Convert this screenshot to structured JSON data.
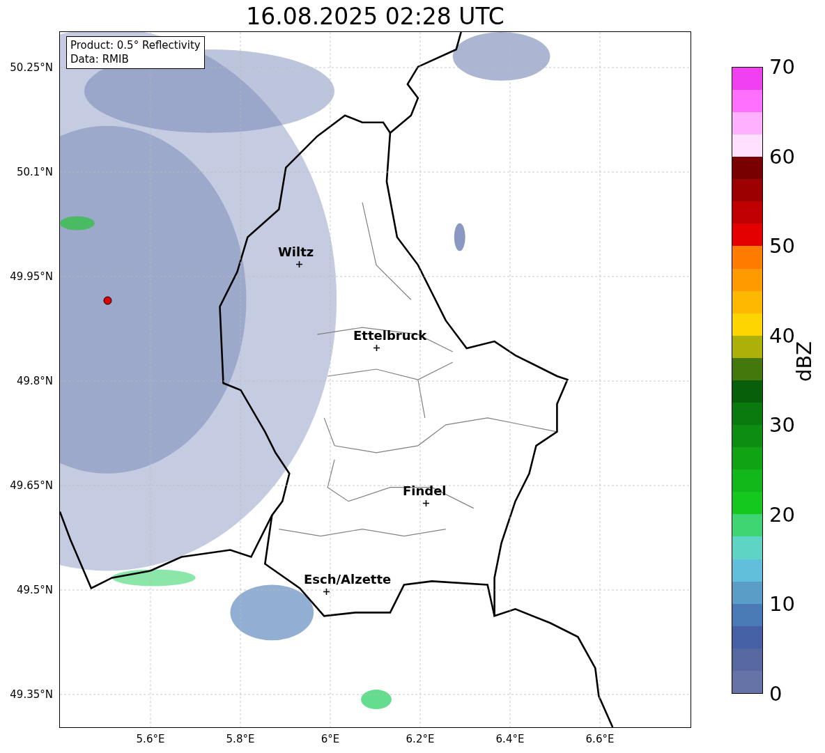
{
  "title": "16.08.2025 02:28 UTC",
  "info_box": {
    "lines": [
      "Product: 0.5° Reflectivity",
      "Data: RMIB"
    ]
  },
  "map": {
    "cities": [
      {
        "name": "Wiltz"
      },
      {
        "name": "Ettelbruck"
      },
      {
        "name": "Findel"
      },
      {
        "name": "Esch/Alzette"
      }
    ],
    "y_ticks": [
      "50.25°N",
      "50.1°N",
      "49.95°N",
      "49.8°N",
      "49.65°N",
      "49.5°N",
      "49.35°N"
    ],
    "x_ticks": [
      "5.6°E",
      "5.8°E",
      "6°E",
      "6.2°E",
      "6.4°E",
      "6.6°E"
    ]
  },
  "colorbar": {
    "label": "dBZ",
    "ticks": [
      "70",
      "60",
      "50",
      "40",
      "30",
      "20",
      "10",
      "0"
    ],
    "segments": [
      {
        "color": "#6673a6"
      },
      {
        "color": "#5767a0"
      },
      {
        "color": "#4560a5"
      },
      {
        "color": "#4a7ab5"
      },
      {
        "color": "#5a9ec8"
      },
      {
        "color": "#62bfdc"
      },
      {
        "color": "#5ed5c4"
      },
      {
        "color": "#3dd672"
      },
      {
        "color": "#14c81e"
      },
      {
        "color": "#12b81a"
      },
      {
        "color": "#10a414"
      },
      {
        "color": "#0e8e10"
      },
      {
        "color": "#0b7a0e"
      },
      {
        "color": "#085f0a"
      },
      {
        "color": "#44780c"
      },
      {
        "color": "#aeb00a"
      },
      {
        "color": "#ffd500"
      },
      {
        "color": "#ffb800"
      },
      {
        "color": "#ff9a00"
      },
      {
        "color": "#ff7c00"
      },
      {
        "color": "#e40000"
      },
      {
        "color": "#c00000"
      },
      {
        "color": "#9c0000"
      },
      {
        "color": "#780000"
      },
      {
        "color": "#ffe0ff"
      },
      {
        "color": "#ffb0ff"
      },
      {
        "color": "#ff70ff"
      },
      {
        "color": "#f040f0"
      }
    ]
  }
}
